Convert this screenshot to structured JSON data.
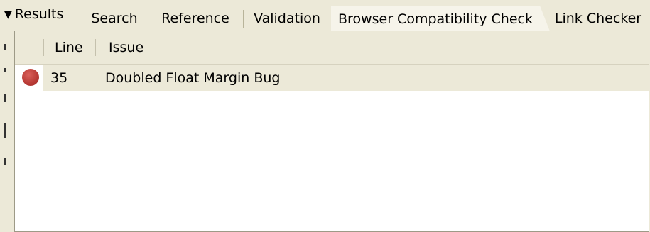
{
  "panel": {
    "title": "Results",
    "collapse_icon": "triangle-down-icon"
  },
  "tabs": [
    {
      "label": "Search",
      "active": false
    },
    {
      "label": "Reference",
      "active": false
    },
    {
      "label": "Validation",
      "active": false
    },
    {
      "label": "Browser Compatibility Check",
      "active": true
    },
    {
      "label": "Link Checker",
      "active": false
    }
  ],
  "table": {
    "columns": [
      "Line",
      "Issue"
    ],
    "rows": [
      {
        "status_icon": "error-red-dot-icon",
        "status_color": "#c0403b",
        "line": "35",
        "issue": "Doubled Float Margin Bug"
      }
    ]
  }
}
